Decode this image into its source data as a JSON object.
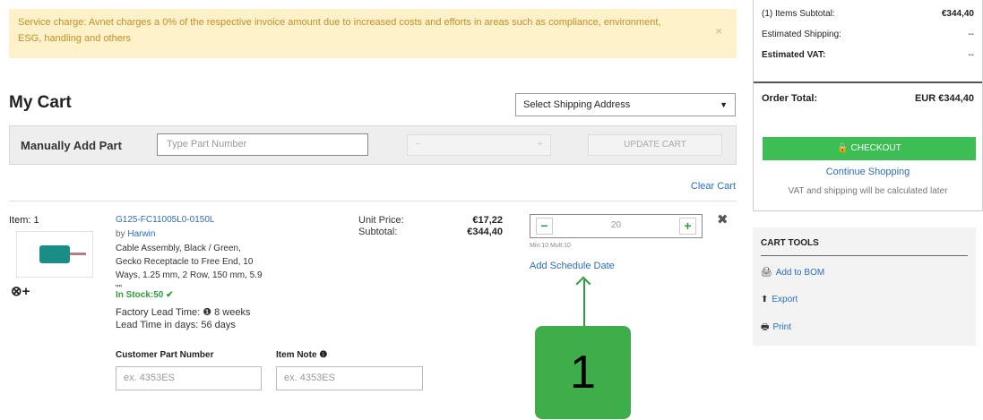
{
  "notice": {
    "text": "Service charge: Avnet charges a 0% of the respective invoice amount due to increased costs and efforts in areas such as compliance, environment, ESG, handling and others",
    "close": "×"
  },
  "cart": {
    "title": "My Cart",
    "shipping_select": "Select Shipping Address",
    "manual_add_label": "Manually Add Part",
    "part_placeholder": "Type Part Number",
    "update_label": "UPDATE CART",
    "clear_label": "Clear Cart"
  },
  "item": {
    "number": "Item: 1",
    "part_number": "G125-FC11005L0-0150L",
    "by": "by",
    "brand": "Harwin",
    "description": "Cable Assembly, Black / Green, Gecko Receptacle to Free End, 10 Ways, 1.25 mm, 2 Row, 150 mm, 5.9 \"\"",
    "stock": "In Stock:50 ✔",
    "factory_lead": "Factory Lead Time:  ❶  8 weeks",
    "lead_days": "Lead Time in days:  56 days",
    "unit_price_label": "Unit Price:",
    "unit_price": "€17,22",
    "subtotal_label": "Subtotal:",
    "subtotal": "€344,40",
    "qty": "20",
    "minmult": "Min:10 Mult:10",
    "schedule": "Add Schedule Date",
    "cpn_label": "Customer Part Number",
    "cpn_placeholder": "ex. 4353ES",
    "note_label": "Item Note ❶",
    "note_placeholder": "ex. 4353ES",
    "compare": "⊗+"
  },
  "summary": {
    "items_subtotal_label": "(1) Items Subtotal:",
    "items_subtotal": "€344,40",
    "shipping_label": "Estimated Shipping:",
    "shipping": "--",
    "vat_label": "Estimated VAT:",
    "vat": "--",
    "total_label": "Order Total:",
    "total": "EUR €344,40",
    "checkout": "🔒 CHECKOUT",
    "continue": "Continue Shopping",
    "note": "VAT and shipping will be calculated later"
  },
  "tools": {
    "header": "CART TOOLS",
    "bom": "Add to BOM",
    "export": "Export",
    "print": "Print"
  },
  "annotation": {
    "badge": "1"
  },
  "colors": {
    "accent_green": "#3dae4a",
    "link_blue": "#2a6ebb",
    "notice_bg": "#fdf1c9"
  }
}
